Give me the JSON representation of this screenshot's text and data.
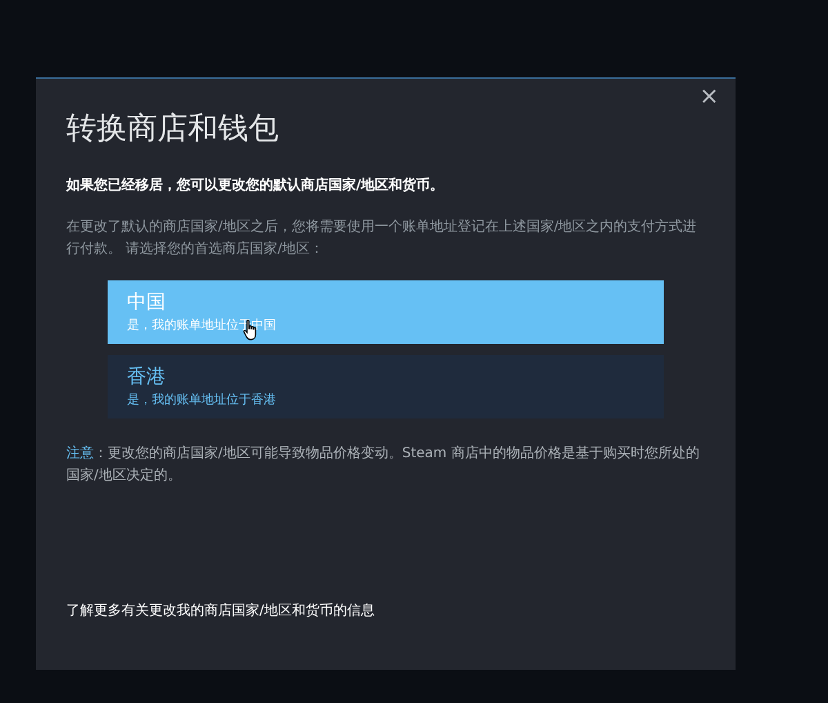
{
  "dialog": {
    "title": "转换商店和钱包",
    "close": "×",
    "intro": "如果您已经移居，您可以更改您的默认商店国家/地区和货币。",
    "instructions": "在更改了默认的商店国家/地区之后，您将需要使用一个账单地址登记在上述国家/地区之内的支付方式进行付款。 请选择您的首选商店国家/地区：",
    "options": [
      {
        "name": "中国",
        "detail": "是，我的账单地址位于中国",
        "selected": true
      },
      {
        "name": "香港",
        "detail": "是，我的账单地址位于香港",
        "selected": false
      }
    ],
    "note_label": "注意",
    "note": "：更改您的商店国家/地区可能导致物品价格变动。Steam 商店中的物品价格是基于购买时您所处的国家/地区决定的。",
    "link": "了解更多有关更改我的商店国家/地区和货币的信息"
  }
}
